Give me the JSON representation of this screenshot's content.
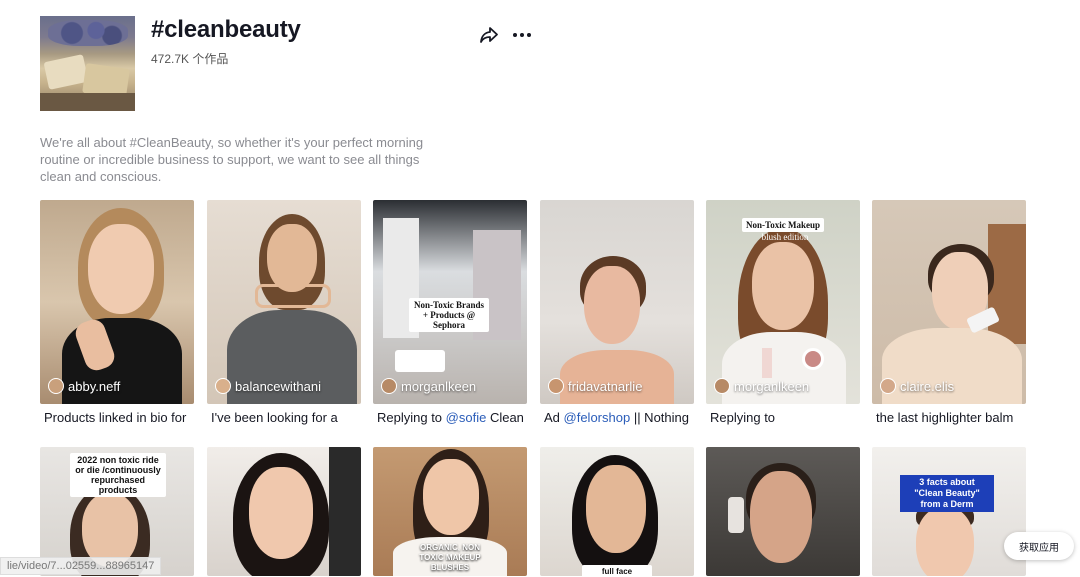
{
  "header": {
    "title": "#cleanbeauty",
    "count": "472.7K 个作品",
    "share_icon": "share-icon",
    "more_icon": "more-icon"
  },
  "description": "We're all about #CleanBeauty, so whether it's your perfect morning routine or incredible business to support, we want to see all things clean and conscious.",
  "videos_row1": [
    {
      "author": "abby.neff",
      "caption_pre": "Products linked in bio for",
      "caption_tag": "",
      "caption_post": ""
    },
    {
      "author": "balancewithani",
      "caption_pre": "I've been looking for a",
      "caption_tag": "",
      "caption_post": ""
    },
    {
      "author": "morganlkeen",
      "caption_pre": "Replying to ",
      "caption_tag": "@sofie",
      "caption_post": " Clean",
      "overlay": "Non-Toxic Brands + Products @ Sephora"
    },
    {
      "author": "fridavatnarlie",
      "caption_pre": "Ad ",
      "caption_tag": "@felorshop",
      "caption_post": " || Nothing"
    },
    {
      "author": "morganlkeen",
      "caption_pre": "Replying to",
      "caption_tag": "",
      "caption_post": "",
      "overlay_top": "Non-Toxic Makeup",
      "overlay_sub": "blush edition"
    },
    {
      "author": "claire.elis",
      "caption_pre": "the last highlighter balm",
      "caption_tag": "",
      "caption_post": ""
    }
  ],
  "videos_row2": [
    {
      "overlay": "2022 non toxic ride or die /continuously repurchased products"
    },
    {
      "overlay": ""
    },
    {
      "overlay": "ORGANIC, NON TOXIC MAKEUP BLUSHES"
    },
    {
      "overlay": "full face affordable"
    },
    {
      "overlay": ""
    },
    {
      "overlay": "3 facts about \"Clean Beauty\" from a Derm"
    }
  ],
  "status_url": "lie/video/7...02559...88965147",
  "get_app": "获取应用"
}
